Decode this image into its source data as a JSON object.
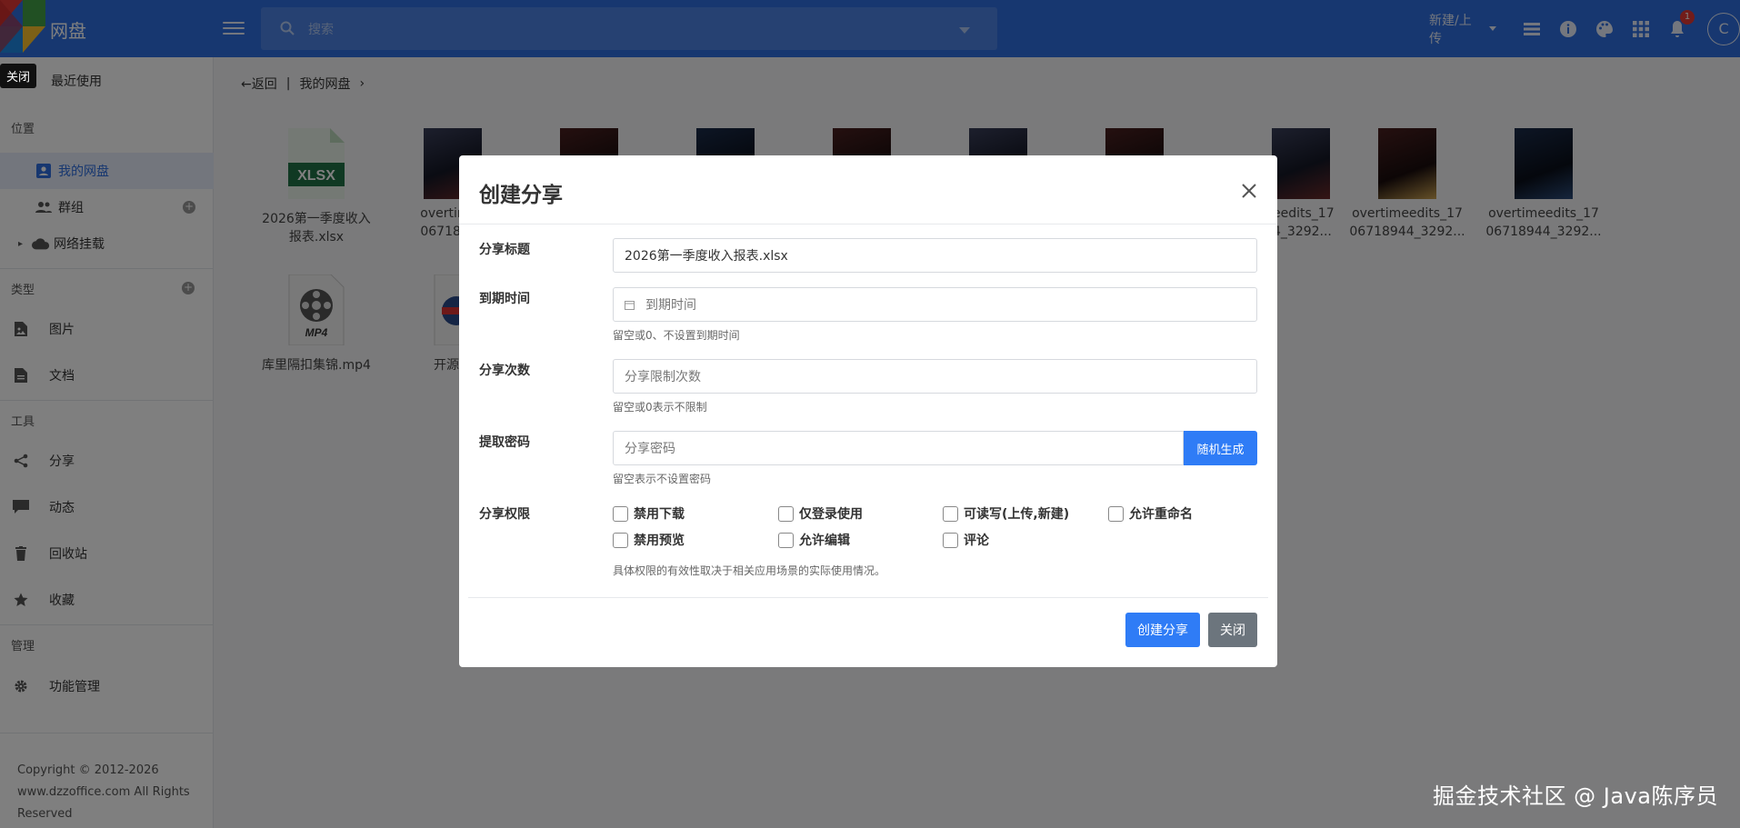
{
  "topbar": {
    "brand": "网盘",
    "search_placeholder": "搜索",
    "new_upload": "新建/上传",
    "notification_count": "1",
    "avatar_letter": "C"
  },
  "tooltip": "关闭",
  "sidebar": {
    "recent": "最近使用",
    "section_location": "位置",
    "my_drive": "我的网盘",
    "groups": "群组",
    "network_mount": "网络挂载",
    "section_type": "类型",
    "images": "图片",
    "documents": "文档",
    "section_tools": "工具",
    "share": "分享",
    "activity": "动态",
    "recycle": "回收站",
    "favorites": "收藏",
    "section_manage": "管理",
    "feature_manage": "功能管理",
    "copyright": "Copyright © 2012-2026 www.dzzoffice.com All Rights Reserved"
  },
  "breadcrumb": {
    "back": "返回",
    "separator": "|",
    "current": "我的网盘",
    "arrow": "›"
  },
  "files": [
    {
      "name": "2026第一季度收入报表.xlsx",
      "type": "xlsx",
      "badge": "XLSX"
    },
    {
      "name": "overtimeedits_1706718944_3292...",
      "type": "photo"
    },
    {
      "name": "overtimeedits_1706718944_3292...",
      "type": "photo"
    },
    {
      "name": "overtimeedits_1706718944_3292...",
      "type": "photo"
    },
    {
      "name": "overtimeedits_1706718944_3292...",
      "type": "photo"
    },
    {
      "name": "overtimeedits_1706718944_3292...",
      "type": "photo"
    },
    {
      "name": "overtimeedits_1706718944_3292...",
      "type": "photo"
    },
    {
      "name": "overtimeedits_1706718944_3292...",
      "type": "photo"
    },
    {
      "name": "overtimeedits_1706718944_3292...",
      "type": "photo"
    },
    {
      "name": "overtimeedits_1706718944_3292...",
      "type": "photo"
    },
    {
      "name": "库里隔扣集锦.mp4",
      "type": "mp4",
      "badge": "MP4"
    },
    {
      "name": "开源项",
      "type": "other"
    }
  ],
  "file_labels": {
    "f0_line1": "2026第一季度收入",
    "f0_line2": "报表.xlsx",
    "f1_line1": "overtimee",
    "f1_line2": "06718944",
    "f7_line1": "eedits_17",
    "f7_line2": "4_3292...",
    "f8_line1": "overtimeedits_17",
    "f8_line2": "06718944_3292...",
    "f9_line1": "overtimeedits_17",
    "f9_line2": "06718944_3292...",
    "f10": "库里隔扣集锦.mp4",
    "f11": "开源项"
  },
  "modal": {
    "title": "创建分享",
    "fields": {
      "title_label": "分享标题",
      "title_value": "2026第一季度收入报表.xlsx",
      "expire_label": "到期时间",
      "expire_placeholder": "到期时间",
      "expire_help": "留空或0、不设置到期时间",
      "count_label": "分享次数",
      "count_placeholder": "分享限制次数",
      "count_help": "留空或0表示不限制",
      "password_label": "提取密码",
      "password_placeholder": "分享密码",
      "password_button": "随机生成",
      "password_help": "留空表示不设置密码",
      "perm_label": "分享权限",
      "perm_help": "具体权限的有效性取决于相关应用场景的实际使用情况。"
    },
    "permissions": [
      "禁用下载",
      "仅登录使用",
      "可读写(上传,新建)",
      "允许重命名",
      "禁用预览",
      "允许编辑",
      "评论"
    ],
    "create_button": "创建分享",
    "close_button": "关闭"
  },
  "watermark": "掘金技术社区 @ Java陈序员",
  "colors": {
    "topbar": "#2f6fe0",
    "primary_button": "#2f7cf6",
    "secondary_button": "#6c757d",
    "active_nav": "#e6edfb"
  }
}
